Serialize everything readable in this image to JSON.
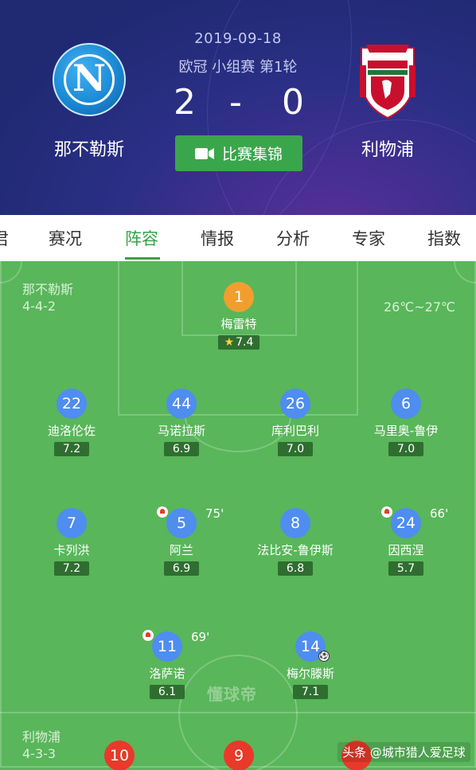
{
  "match": {
    "date": "2019-09-18",
    "competition": "欧冠 小组赛 第1轮",
    "home_score": "2",
    "separator": "-",
    "away_score": "0",
    "home_team": "那不勒斯",
    "away_team": "利物浦",
    "home_logo_letter": "N",
    "highlights_label": "比赛集锦"
  },
  "tabs": [
    {
      "label": "君"
    },
    {
      "label": "赛况"
    },
    {
      "label": "阵容"
    },
    {
      "label": "情报"
    },
    {
      "label": "分析"
    },
    {
      "label": "专家"
    },
    {
      "label": "指数"
    }
  ],
  "active_tab": "阵容",
  "lineup": {
    "home": {
      "name": "那不勒斯",
      "formation": "4-4-2"
    },
    "away": {
      "name": "利物浦",
      "formation": "4-3-3"
    },
    "weather": "26℃~27℃",
    "players": [
      {
        "number": "1",
        "name": "梅雷特",
        "rating": "7.4",
        "star": true
      },
      {
        "number": "22",
        "name": "迪洛伦佐",
        "rating": "7.2"
      },
      {
        "number": "44",
        "name": "马诺拉斯",
        "rating": "6.9"
      },
      {
        "number": "26",
        "name": "库利巴利",
        "rating": "7.0"
      },
      {
        "number": "6",
        "name": "马里奥-鲁伊",
        "rating": "7.0"
      },
      {
        "number": "7",
        "name": "卡列洪",
        "rating": "7.2"
      },
      {
        "number": "5",
        "name": "阿兰",
        "rating": "6.9",
        "sub_minute": "75'"
      },
      {
        "number": "8",
        "name": "法比安-鲁伊斯",
        "rating": "6.8"
      },
      {
        "number": "24",
        "name": "因西涅",
        "rating": "5.7",
        "sub_minute": "66'"
      },
      {
        "number": "11",
        "name": "洛萨诺",
        "rating": "6.1",
        "sub_minute": "69'"
      },
      {
        "number": "14",
        "name": "梅尔滕斯",
        "rating": "7.1",
        "goal": true
      }
    ],
    "away_partial": [
      {
        "number": "10"
      },
      {
        "number": "9"
      }
    ]
  },
  "watermark": "懂球帝",
  "source_tag": "头条 @城市猎人爱足球",
  "colors": {
    "pitch": "#59b65a",
    "accent": "#35a34a",
    "home_badge": "#4f8def",
    "goalkeeper_badge": "#f19e2e",
    "away_badge": "#e8392a"
  },
  "icons": {
    "highlights": "video-camera-icon",
    "substitution": "sub-out-arrow-icon",
    "goal": "soccer-ball-icon",
    "rating_star": "star-icon"
  }
}
